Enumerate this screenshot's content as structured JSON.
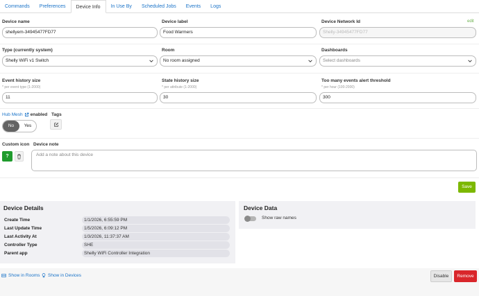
{
  "tabs": [
    "Commands",
    "Preferences",
    "Device Info",
    "In Use By",
    "Scheduled Jobs",
    "Events",
    "Logs"
  ],
  "active_tab": "Device Info",
  "fields": {
    "device_name": {
      "label": "Device name",
      "value": "shellyem-34945477FD77"
    },
    "device_label": {
      "label": "Device label",
      "value": "Food Warmers"
    },
    "device_network_id": {
      "label": "Device Network Id",
      "value": "Shelly-34945477FD77",
      "edit": "edit"
    },
    "type": {
      "label": "Type (currently system)",
      "value": "Shelly WiFi v1 Switch"
    },
    "room": {
      "label": "Room",
      "value": "No room assigned"
    },
    "dashboards": {
      "label": "Dashboards",
      "placeholder": "Select dashboards"
    },
    "event_history": {
      "label": "Event history size",
      "hint": "* per event type (1-2000)",
      "value": "11"
    },
    "state_history": {
      "label": "State history size",
      "hint": "* per attribute (1-2000)",
      "value": "30"
    },
    "alert_threshold": {
      "label": "Too many events alert threshold",
      "hint": "* per hour (100-2000)",
      "value": "300"
    }
  },
  "hub_mesh": {
    "link": "Hub Mesh",
    "suffix": "enabled",
    "no": "No",
    "yes": "Yes",
    "selected": "No"
  },
  "tags": {
    "label": "Tags"
  },
  "custom_icon": {
    "label": "Custom icon",
    "button": "?"
  },
  "device_note": {
    "label": "Device note",
    "placeholder": "Add a note about this device"
  },
  "save_label": "Save",
  "device_details": {
    "title": "Device Details",
    "rows": [
      {
        "key": "Create Time",
        "value": "1/1/2026, 6:55:59 PM"
      },
      {
        "key": "Last Update Time",
        "value": "1/5/2026, 6:09:12 PM"
      },
      {
        "key": "Last Activity At",
        "value": "1/3/2026, 11:37:37 AM"
      },
      {
        "key": "Controller Type",
        "value": "SHE"
      },
      {
        "key": "Parent app",
        "value": "Shelly WiFi Controller Integration"
      }
    ]
  },
  "device_data": {
    "title": "Device Data",
    "toggle_label": "Show raw names"
  },
  "footer": {
    "show_in_rooms": "Show in Rooms",
    "show_in_devices": "Show in Devices",
    "disable": "Disable",
    "remove": "Remove"
  },
  "colors": {
    "link": "#1a73c8",
    "save": "#7cb800",
    "remove": "#d9262b",
    "icon_green": "#1f9b2d"
  },
  "icons": [
    "external-link-icon",
    "edit-icon",
    "trash-icon",
    "chevron-down-icon",
    "rooms-icon",
    "lightbulb-icon"
  ]
}
